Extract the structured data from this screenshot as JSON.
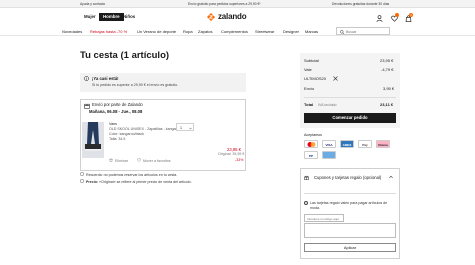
{
  "topbar": {
    "help": "Ayuda y contacto",
    "shipping": "Envío gratuito para pedidos superiores a 29,90 €*",
    "returns": "Devoluciones gratuitas durante 30 días"
  },
  "header": {
    "tabs": [
      "Mujer",
      "Hombre",
      "Niños"
    ],
    "logo": "zalando",
    "cart_count": "1"
  },
  "nav": {
    "items": [
      "Novedades",
      "Rebajas hasta -70 %",
      "Un Verano de deporte",
      "Ropa",
      "Zapatos",
      "Complementos",
      "Streetwear",
      "Designer",
      "Marcas"
    ],
    "search_placeholder": "Buscar"
  },
  "cart": {
    "title": "Tu cesta (1 artículo)",
    "notice_title": "¡Ya casi está!",
    "notice_text": "Si tu pedido es superior a 29,90 € el envío es gratuito.",
    "shipper": "Envío por parte de Zalando",
    "delivery": "Mañana, 06.08 - Jue., 08.08",
    "item": {
      "brand": "Vans",
      "name": "OLD SKOOL UNISEX - Zapatillas - kangaroo/black",
      "color": "Color: kangaroo/black",
      "size": "Talla: 34.5",
      "quantity": "1",
      "price_now": "23,95 €",
      "price_orig": "Original: 35,95 €",
      "discount": "-33%",
      "remove": "Eliminar",
      "wishlist": "Mover a favoritos"
    },
    "footnote_1": "Recuerda: no podemos reservar los artículos en tu cesta.",
    "footnote_2_bold": "Precio:",
    "footnote_2": " «Original» se refiere al primer precio de venta del artículo."
  },
  "summary": {
    "subtotal_label": "Subtotal",
    "subtotal": "23,95 €",
    "voucher_label": "Vale",
    "voucher": "-4,79 €",
    "voucher_code": "ULTIMOS20",
    "shipping_label": "Envío",
    "shipping": "3,95 €",
    "total_label": "Total",
    "total_vat": "IVA incluido",
    "total": "23,11 €",
    "checkout": "Comenzar pedido",
    "accepted": "Aceptamos",
    "payments": [
      "MC",
      "VISA",
      "AMEX",
      "Pay",
      "Klarna",
      "PP",
      "Apple"
    ]
  },
  "voucher_panel": {
    "title": "Cupones y tarjetas regalo (opcional)",
    "info": "Las tarjetas regalo valen para pagar artículos de moda.",
    "input_placeholder": "Introduce el código aquí",
    "apply": "Aplicar"
  },
  "colors": {
    "accent": "#ff6900",
    "sale": "#d0021b",
    "dark": "#1a1a1a"
  }
}
